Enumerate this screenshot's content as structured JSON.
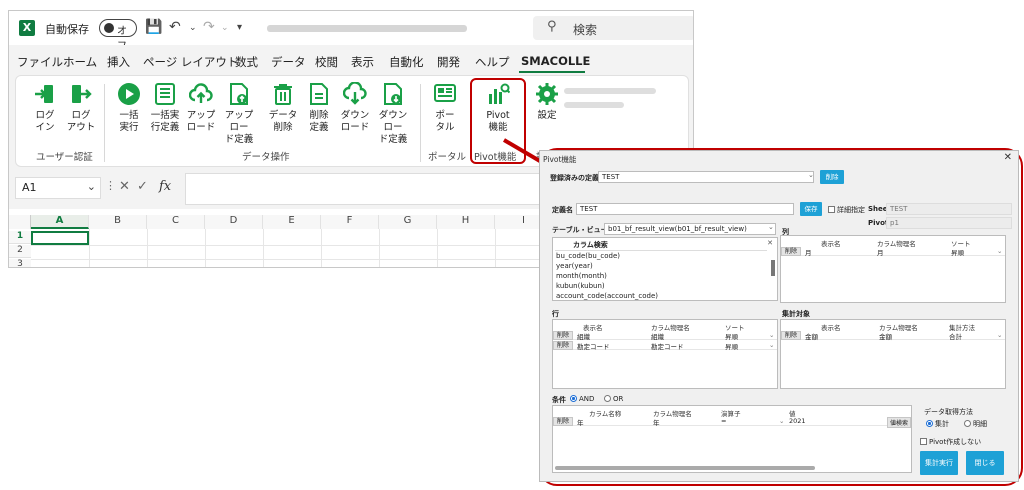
{
  "excel": {
    "autosave_label": "自動保存",
    "autosave_state": "オフ",
    "search_placeholder": "検索",
    "menu": [
      "ファイル",
      "ホーム",
      "挿入",
      "ページ レイアウト",
      "数式",
      "データ",
      "校閲",
      "表示",
      "自動化",
      "開発",
      "ヘルプ",
      "SMACOLLE"
    ],
    "ribbon": {
      "login": "ログ\nイン",
      "logout": "ログ\nアウト",
      "bulk_run": "一括\n実行",
      "bulk_def": "一括実\n行定義",
      "upload": "アップ\nロード",
      "upload_def": "アップロー\nド定義",
      "data_delete": "データ\n削除",
      "delete_def": "削除\n定義",
      "download": "ダウン\nロード",
      "download_def": "ダウンロー\nド定義",
      "portal": "ポー\nタル",
      "pivot": "Pivot\n機能",
      "settings": "設定"
    },
    "groups": {
      "user_auth": "ユーザー認証",
      "data_ops": "データ操作",
      "portal": "ポータル",
      "pivot": "Pivot機能",
      "settings": "設定"
    },
    "namebox": "A1",
    "columns": [
      "A",
      "B",
      "C",
      "D",
      "E",
      "F",
      "G",
      "H",
      "I"
    ],
    "rows": [
      "1",
      "2",
      "3"
    ]
  },
  "pivot": {
    "title": "Pivot機能",
    "saved_def_label": "登録済みの定義",
    "saved_def_value": "TEST",
    "delete_btn": "削除",
    "def_name_label": "定義名",
    "def_name_value": "TEST",
    "save_btn": "保存",
    "detail_label": "詳細指定",
    "sheet_label": "Sheet",
    "sheet_value": "TEST",
    "pivot_label": "Pivot",
    "pivot_value": "p1",
    "table_view_label": "テーブル・ビュー",
    "table_view_value": "b01_bf_result_view(b01_bf_result_view)",
    "column_search_label": "カラム検索",
    "column_list": [
      "bu_code(bu_code)",
      "year(year)",
      "month(month)",
      "kubun(kubun)",
      "account_code(account_code)"
    ],
    "col_section": "列",
    "row_section": "行",
    "agg_section": "集計対象",
    "hdr_display": "表示名",
    "hdr_physical": "カラム物理名",
    "hdr_sort": "ソート",
    "hdr_agg_method": "集計方法",
    "del": "削除",
    "col_rows": [
      {
        "display": "月",
        "physical": "月",
        "sort": "昇順"
      }
    ],
    "row_rows": [
      {
        "display": "組織",
        "physical": "組織",
        "sort": "昇順"
      },
      {
        "display": "勘定コード",
        "physical": "勘定コード",
        "sort": "昇順"
      }
    ],
    "agg_rows": [
      {
        "display": "金額",
        "physical": "金額",
        "method": "合計"
      }
    ],
    "cond_label": "条件",
    "cond_and": "AND",
    "cond_or": "OR",
    "cond_hdr_name": "カラム名称",
    "cond_hdr_physical": "カラム物理名",
    "cond_hdr_op": "演算子",
    "cond_hdr_value": "値",
    "cond_rows": [
      {
        "name": "年",
        "physical": "年",
        "op": "=",
        "value": "2021",
        "btn": "値検索"
      }
    ],
    "fetch_method_label": "データ取得方法",
    "fetch_agg": "集計",
    "fetch_detail": "明細",
    "no_pivot_label": "Pivot作成しない",
    "run_btn": "集計実行",
    "close_btn": "閉じる"
  }
}
